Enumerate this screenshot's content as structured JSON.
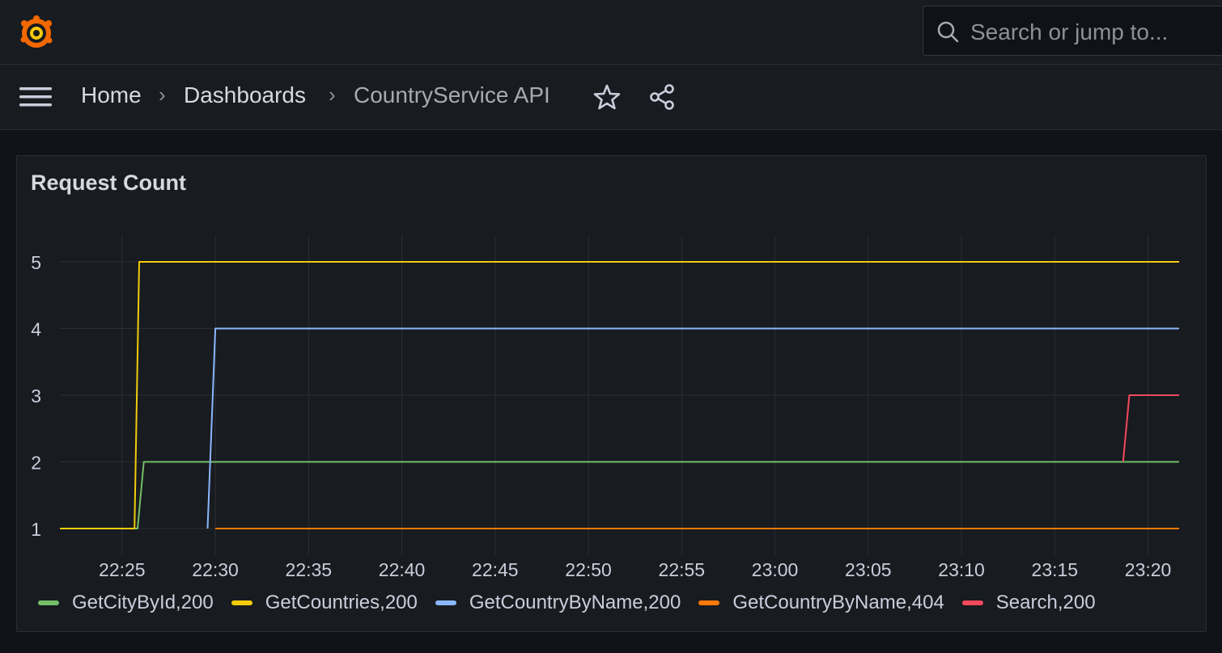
{
  "search": {
    "placeholder": "Search or jump to..."
  },
  "breadcrumbs": {
    "home": "Home",
    "sep1": "›",
    "dashboards": "Dashboards",
    "sep2": "›",
    "current": "CountryService API"
  },
  "panel": {
    "title": "Request Count"
  },
  "icons": {
    "logo": "grafana-logo",
    "search": "search-icon",
    "menu": "hamburger-menu-icon",
    "star": "star-icon",
    "share": "share-icon"
  },
  "colors": {
    "green": "#73bf69",
    "yellow": "#f2cc0c",
    "blue": "#8ab8ff",
    "orange": "#ff780a",
    "red": "#f2495c",
    "accent": "#f46800"
  },
  "chart_data": {
    "type": "line",
    "title": "Request Count",
    "xlabel": "",
    "ylabel": "",
    "x_ticks": [
      "22:25",
      "22:30",
      "22:35",
      "22:40",
      "22:45",
      "22:50",
      "22:55",
      "23:00",
      "23:05",
      "23:10",
      "23:15",
      "23:20"
    ],
    "y_ticks": [
      1,
      2,
      3,
      4,
      5
    ],
    "xlim": [
      "22:21:40",
      "23:21:40"
    ],
    "ylim": [
      0.6,
      5.4
    ],
    "grid": true,
    "legend_position": "bottom",
    "series": [
      {
        "name": "GetCityById,200",
        "color": "#73bf69",
        "points": [
          [
            "22:21:40",
            1
          ],
          [
            "22:25:50",
            1
          ],
          [
            "22:26:10",
            2
          ],
          [
            "23:21:40",
            2
          ]
        ]
      },
      {
        "name": "GetCountries,200",
        "color": "#f2cc0c",
        "points": [
          [
            "22:21:40",
            1
          ],
          [
            "22:25:40",
            1
          ],
          [
            "22:25:55",
            5
          ],
          [
            "23:21:40",
            5
          ]
        ]
      },
      {
        "name": "GetCountryByName,200",
        "color": "#8ab8ff",
        "points": [
          [
            "22:29:35",
            1
          ],
          [
            "22:30:00",
            4
          ],
          [
            "23:21:40",
            4
          ]
        ]
      },
      {
        "name": "GetCountryByName,404",
        "color": "#ff780a",
        "points": [
          [
            "22:30:00",
            1
          ],
          [
            "23:21:40",
            1
          ]
        ]
      },
      {
        "name": "Search,200",
        "color": "#f2495c",
        "points": [
          [
            "23:18:40",
            2
          ],
          [
            "23:19:00",
            3
          ],
          [
            "23:21:40",
            3
          ]
        ]
      }
    ]
  }
}
